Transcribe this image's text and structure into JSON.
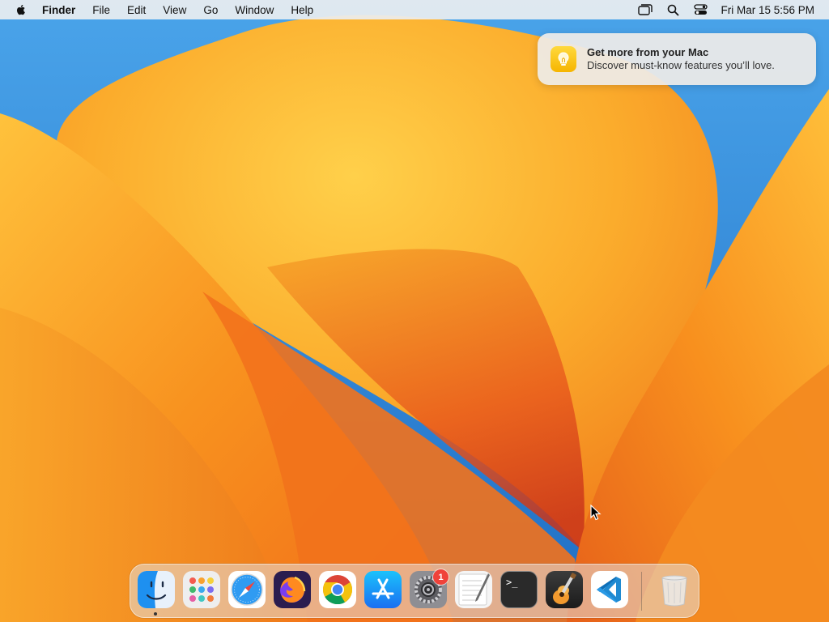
{
  "menubar": {
    "app_name": "Finder",
    "menus": [
      "File",
      "Edit",
      "View",
      "Go",
      "Window",
      "Help"
    ],
    "clock": "Fri Mar 15  5:56 PM",
    "status_icons": [
      "screen-mirroring-icon",
      "spotlight-search-icon",
      "control-center-icon"
    ]
  },
  "notification": {
    "icon": "lightbulb-icon",
    "title": "Get more from your Mac",
    "body": "Discover must-know features you’ll love."
  },
  "dock": {
    "apps": [
      {
        "name": "finder",
        "running": true
      },
      {
        "name": "launchpad",
        "running": false
      },
      {
        "name": "safari",
        "running": false
      },
      {
        "name": "firefox",
        "running": false
      },
      {
        "name": "chrome",
        "running": false
      },
      {
        "name": "app-store",
        "running": false
      },
      {
        "name": "system-settings",
        "running": false,
        "badge": "1"
      },
      {
        "name": "textedit",
        "running": false
      },
      {
        "name": "terminal",
        "running": false
      },
      {
        "name": "garageband",
        "running": false
      },
      {
        "name": "vscode",
        "running": false
      },
      {
        "name": "trash",
        "running": false
      }
    ],
    "settings_badge": "1",
    "terminal_prompt": ">_"
  },
  "colors": {
    "wallpaper_blue": "#2f8bd6",
    "wallpaper_orange": "#f6951e",
    "badge_red": "#f0423a"
  }
}
